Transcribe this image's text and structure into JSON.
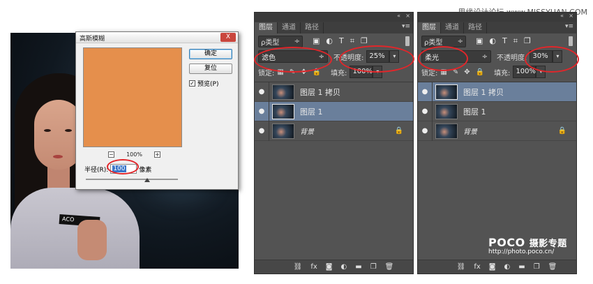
{
  "watermark": "思缘设计论坛 www.MISSYUAN.COM",
  "poco": {
    "brand": "POCO",
    "subtitle": "摄影专题",
    "url": "http://photo.poco.cn/"
  },
  "photo": {
    "shirt_tag": "ACO"
  },
  "dialog": {
    "title": "高斯模糊",
    "close_label": "X",
    "ok_label": "确定",
    "reset_label": "复位",
    "preview_label": "预览(P)",
    "preview_checked": "✓",
    "zoom_minus": "−",
    "zoom_plus": "+",
    "zoom_level": "100%",
    "radius_label": "半径(R):",
    "radius_value": "100",
    "radius_unit": "像素",
    "preview_color": "#e58f4c"
  },
  "panel_common": {
    "tabs": [
      "图层",
      "通道",
      "路径"
    ],
    "collapse": "«",
    "close": "×",
    "menu": "▾≡",
    "filter_label": "ρ类型",
    "filter_arrow": "÷",
    "filter_icons": [
      "▣",
      "◐",
      "T",
      "⌗",
      "❐"
    ],
    "opacity_label": "不透明度:",
    "lock_label": "锁定:",
    "lock_icons": [
      "▦",
      "✎",
      "✥",
      "🔒"
    ],
    "fill_label": "填充:",
    "fill_value": "100%",
    "dropdown_arrow": "▾",
    "eye": "●",
    "bg_lock": "🔒",
    "bottom_icons": [
      "⛓",
      "fx",
      "◙",
      "◐",
      "▬",
      "❐",
      "🗑"
    ]
  },
  "panel_left": {
    "blend_mode": "滤色",
    "opacity": "25%",
    "layers": [
      {
        "name": "图层 1 拷贝",
        "selected": false
      },
      {
        "name": "图层 1",
        "selected": true
      },
      {
        "name": "背景",
        "selected": false
      }
    ]
  },
  "panel_right": {
    "blend_mode": "柔光",
    "opacity": "30%",
    "layers": [
      {
        "name": "图层 1 拷贝",
        "selected": true
      },
      {
        "name": "图层 1",
        "selected": false
      },
      {
        "name": "背景",
        "selected": false
      }
    ]
  }
}
